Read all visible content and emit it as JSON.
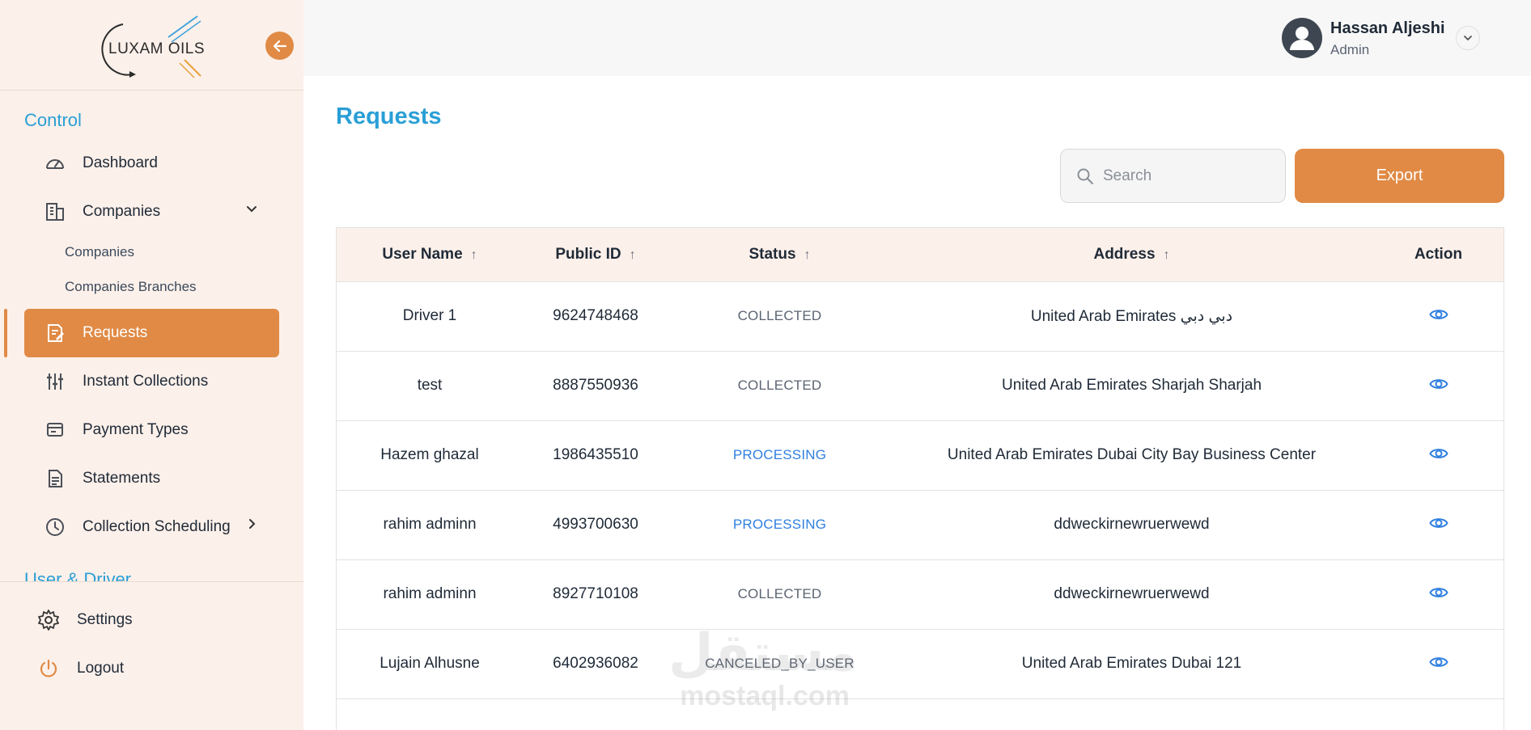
{
  "brand": {
    "logo_text": "LUXAM OILS"
  },
  "sidebar": {
    "section_control": "Control",
    "items": [
      {
        "label": "Dashboard",
        "icon": "gauge-icon"
      },
      {
        "label": "Companies",
        "icon": "building-icon",
        "expanded": true
      },
      {
        "label": "Requests",
        "icon": "edit-document-icon",
        "active": true
      },
      {
        "label": "Instant Collections",
        "icon": "sliders-icon"
      },
      {
        "label": "Payment Types",
        "icon": "receipt-icon"
      },
      {
        "label": "Statements",
        "icon": "document-icon"
      },
      {
        "label": "Collection Scheduling",
        "icon": "clock-icon"
      }
    ],
    "companies_sub": [
      "Companies",
      "Companies Branches"
    ],
    "section_user_driver": "User & Driver",
    "bottom": [
      {
        "label": "Settings",
        "icon": "gear-icon"
      },
      {
        "label": "Logout",
        "icon": "power-icon"
      }
    ]
  },
  "header": {
    "user_name": "Hassan Aljeshi",
    "user_role": "Admin"
  },
  "main": {
    "title": "Requests",
    "search_placeholder": "Search",
    "export_label": "Export",
    "columns": [
      "User Name",
      "Public ID",
      "Status",
      "Address",
      "Action"
    ],
    "rows": [
      {
        "user": "Driver 1",
        "public_id": "9624748468",
        "status": "COLLECTED",
        "address": "United Arab Emirates دبي دبي"
      },
      {
        "user": "test",
        "public_id": "8887550936",
        "status": "COLLECTED",
        "address": "United Arab Emirates Sharjah Sharjah"
      },
      {
        "user": "Hazem ghazal",
        "public_id": "1986435510",
        "status": "PROCESSING",
        "address": "United Arab Emirates Dubai City Bay Business Center"
      },
      {
        "user": "rahim adminn",
        "public_id": "4993700630",
        "status": "PROCESSING",
        "address": "ddweckirnewruerwewd"
      },
      {
        "user": "rahim adminn",
        "public_id": "8927710108",
        "status": "COLLECTED",
        "address": "ddweckirnewruerwewd"
      },
      {
        "user": "Lujain Alhusne",
        "public_id": "6402936082",
        "status": "CANCELED_BY_USER",
        "address": "United Arab Emirates Dubai 121"
      }
    ]
  },
  "watermark": {
    "arabic": "مستقل",
    "latin": "mostaql.com"
  },
  "colors": {
    "accent": "#e08a45",
    "title_blue": "#2a9fd6",
    "status_blue": "#2f7fe0",
    "sidebar_bg": "#fcf0ea"
  }
}
